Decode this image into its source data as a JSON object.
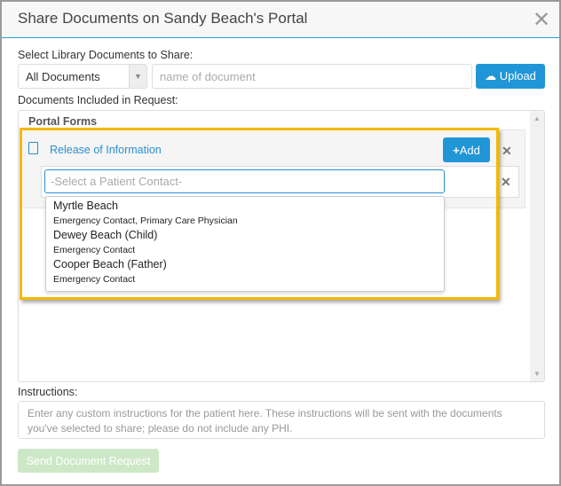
{
  "dialog": {
    "title": "Share Documents on Sandy Beach's Portal",
    "close_icon": "close-icon"
  },
  "library": {
    "label": "Select Library Documents to Share:",
    "filter_value": "All Documents",
    "search_placeholder": "name of document",
    "upload_label": "Upload"
  },
  "included": {
    "label": "Documents Included in Request:",
    "section": "Portal Forms",
    "documents": [
      {
        "name": "Release of Information",
        "add_label": "Add",
        "contact_placeholder": "-Select a Patient Contact-"
      }
    ]
  },
  "contacts": [
    {
      "name": "Myrtle Beach",
      "roles": "Emergency Contact, Primary Care Physician"
    },
    {
      "name": "Dewey Beach (Child)",
      "roles": "Emergency Contact"
    },
    {
      "name": "Cooper Beach (Father)",
      "roles": "Emergency Contact"
    }
  ],
  "instructions": {
    "label": "Instructions:",
    "placeholder": "Enter any custom instructions for the patient here. These instructions will be sent with the documents you've selected to share; please do not include any PHI."
  },
  "send_label": "Send Document Request",
  "colors": {
    "accent": "#2196d6",
    "highlight": "#f5b800",
    "send_disabled": "#cde8c6"
  }
}
